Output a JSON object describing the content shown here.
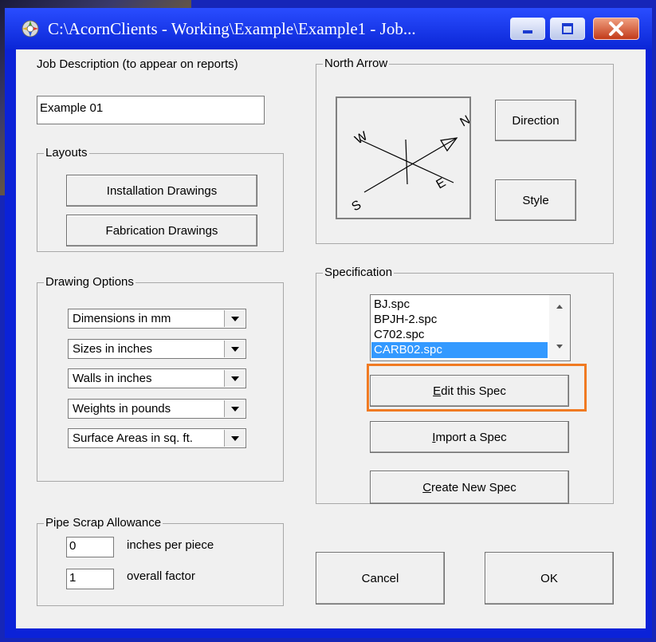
{
  "window": {
    "title": "C:\\AcornClients - Working\\Example\\Example1   -   Job..."
  },
  "job": {
    "description_label": "Job Description (to appear on reports)",
    "description_value": "Example 01"
  },
  "layouts": {
    "group_label": "Layouts",
    "installation_button": "Installation Drawings",
    "fabrication_button": "Fabrication Drawings"
  },
  "drawing_options": {
    "group_label": "Drawing Options",
    "combos": [
      "Dimensions in mm",
      "Sizes in inches",
      "Walls in inches",
      "Weights in pounds",
      "Surface Areas in sq. ft."
    ]
  },
  "scrap": {
    "group_label": "Pipe Scrap Allowance",
    "inches_value": "0",
    "inches_label": "inches per piece",
    "factor_value": "1",
    "factor_label": "overall factor"
  },
  "north_arrow": {
    "group_label": "North Arrow",
    "direction_button": "Direction",
    "style_button": "Style",
    "compass_letters": [
      "N",
      "E",
      "S",
      "W"
    ]
  },
  "specification": {
    "group_label": "Specification",
    "items": [
      "BJ.spc",
      "BPJH-2.spc",
      "C702.spc",
      "CARB02.spc"
    ],
    "selected": "CARB02.spc",
    "edit_button_pre": "",
    "edit_button_key": "E",
    "edit_button_post": "dit this Spec",
    "import_button_pre": "",
    "import_button_key": "I",
    "import_button_post": "mport a Spec",
    "create_button_pre": "",
    "create_button_key": "C",
    "create_button_post": "reate New Spec"
  },
  "footer": {
    "cancel_button": "Cancel",
    "ok_button": "OK"
  },
  "colors": {
    "highlight": "#f07a22",
    "selection": "#3399ff",
    "titlebar": "#0b22d8"
  }
}
